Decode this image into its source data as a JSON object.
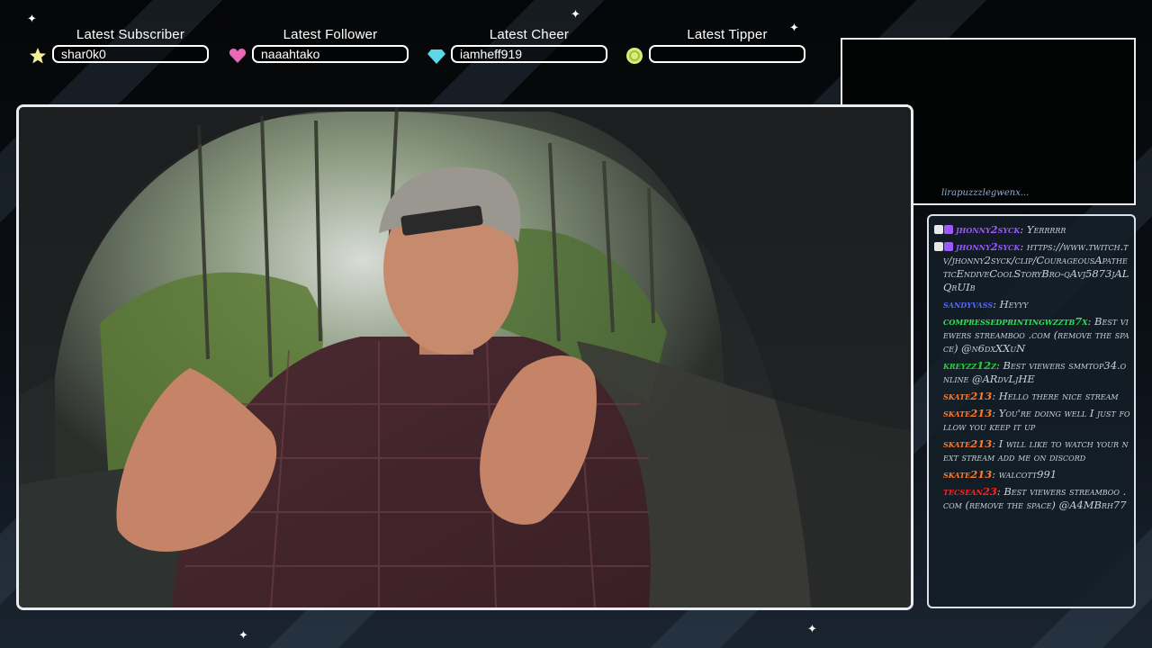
{
  "alerts": [
    {
      "title": "Latest Subscriber",
      "value": "shar0k0",
      "icon": "star-icon",
      "color": "#f4f09a"
    },
    {
      "title": "Latest Follower",
      "value": "naaahtako",
      "icon": "heart-icon",
      "color": "#e86ab4"
    },
    {
      "title": "Latest Cheer",
      "value": "iamheff919",
      "icon": "gem-icon",
      "color": "#5ad8e6"
    },
    {
      "title": "Latest Tipper",
      "value": "",
      "icon": "coin-icon",
      "color": "#d8ec7a"
    }
  ],
  "chat": {
    "overflow_text": "lirapuzzzlegwenx...",
    "messages": [
      {
        "user": "jhonny2syck",
        "color": "#9b59ff",
        "badges": [
          "video-badge",
          "star-badge"
        ],
        "text": "Yerrrrr"
      },
      {
        "user": "jhonny2syck",
        "color": "#9b59ff",
        "badges": [
          "video-badge",
          "star-badge"
        ],
        "text": "https://www.twitch.tv/jhonny2syck/clip/CourageousApatheticEndiveCoolStoryBro-qAvj5873jALQrUIb"
      },
      {
        "user": "sandyvass",
        "color": "#5566ff",
        "badges": [],
        "text": "Heyyy"
      },
      {
        "user": "compressedprintingwzztb7x",
        "color": "#33e05a",
        "badges": [],
        "text": "Best viewers streamboo .com (remove the space) @n6dxXXuN"
      },
      {
        "user": "kreyzz12z",
        "color": "#2fcf3f",
        "badges": [],
        "text": "Best viewers smmtop34.online @ARdvLjHE"
      },
      {
        "user": "skate213",
        "color": "#ff7a2a",
        "badges": [],
        "text": "Hello there nice stream"
      },
      {
        "user": "skate213",
        "color": "#ff7a2a",
        "badges": [],
        "text": "You're doing well I just follow you keep it up"
      },
      {
        "user": "skate213",
        "color": "#ff7a2a",
        "badges": [],
        "text": "I will like to watch your next stream add me on discord"
      },
      {
        "user": "skate213",
        "color": "#ff7a2a",
        "badges": [],
        "text": "walcott991"
      },
      {
        "user": "tecsean23",
        "color": "#ff2222",
        "badges": [],
        "text": "Best viewers streamboo .com (remove the space) @A4MBrh77"
      }
    ]
  },
  "colors": {
    "frame": "#e9edf1",
    "chat_bg": "#141e28"
  }
}
